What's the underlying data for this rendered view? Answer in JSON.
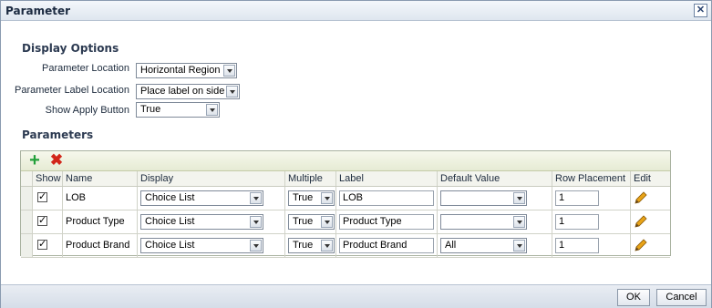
{
  "window": {
    "title": "Parameter"
  },
  "display_options": {
    "heading": "Display Options",
    "fields": [
      {
        "label": "Parameter Location",
        "value": "Horizontal Region"
      },
      {
        "label": "Parameter Label Location",
        "value": "Place label on side"
      },
      {
        "label": "Show Apply Button",
        "value": "True"
      }
    ]
  },
  "parameters": {
    "heading": "Parameters",
    "columns": [
      "Show",
      "Name",
      "Display",
      "Multiple",
      "Label",
      "Default Value",
      "Row Placement",
      "Edit"
    ],
    "rows": [
      {
        "show": "✓",
        "name": "LOB",
        "display": "Choice List",
        "multiple": "True",
        "label": "LOB",
        "default": "",
        "placement": "1"
      },
      {
        "show": "✓",
        "name": "Product Type",
        "display": "Choice List",
        "multiple": "True",
        "label": "Product Type",
        "default": "",
        "placement": "1"
      },
      {
        "show": "✓",
        "name": "Product Brand",
        "display": "Choice List",
        "multiple": "True",
        "label": "Product Brand",
        "default": "All",
        "placement": "1"
      }
    ]
  },
  "footer": {
    "ok_label": "OK",
    "cancel_label": "Cancel"
  },
  "icons": {
    "add": "plus-icon",
    "delete": "x-icon",
    "edit": "pencil-icon",
    "close": "close-icon"
  },
  "colors": {
    "add": "#22a03a",
    "delete": "#d2261a",
    "pencil": "#e8a317"
  }
}
